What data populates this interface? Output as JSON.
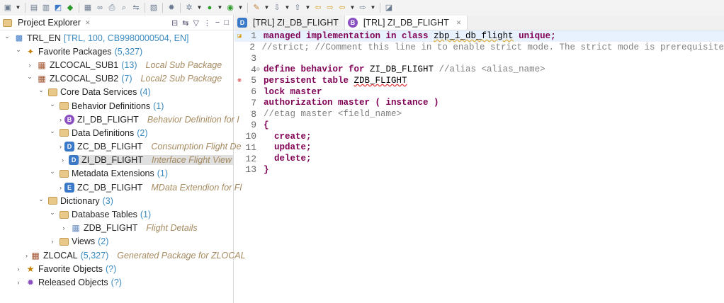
{
  "toolbar": {
    "icons": [
      "new-icon",
      "save-icon",
      "save-all-icon",
      "open-project-icon",
      "run-abap-icon",
      "package-icon",
      "link-icon",
      "print-icon",
      "search-icon",
      "compare-icon",
      "checkin-icon",
      "debug-settings-icon",
      "debug-icon",
      "run-icon",
      "external-tools-icon",
      "pen-icon",
      "next-annotation-icon",
      "prev-annotation-icon",
      "back-edit-icon",
      "forward-edit-icon",
      "back-icon",
      "forward-icon",
      "open-perspective-icon"
    ]
  },
  "explorer": {
    "title": "Project Explorer",
    "tree": [
      {
        "level": 0,
        "open": true,
        "icon": "sys",
        "label": "TRL_EN",
        "count": "[TRL, 100, CB9980000504, EN]"
      },
      {
        "level": 1,
        "open": true,
        "icon": "fav",
        "label": "Favorite Packages",
        "count": "(5,327)"
      },
      {
        "level": 2,
        "open": false,
        "icon": "pkg",
        "label": "ZLCOCAL_SUB1",
        "count": "(13)",
        "desc": "Local Sub Package"
      },
      {
        "level": 2,
        "open": true,
        "icon": "pkg",
        "label": "ZLCOCAL_SUB2",
        "count": "(7)",
        "desc": "Local2 Sub Package"
      },
      {
        "level": 3,
        "open": true,
        "icon": "folder",
        "label": "Core Data Services",
        "count": "(4)"
      },
      {
        "level": 4,
        "open": true,
        "icon": "folder",
        "label": "Behavior Definitions",
        "count": "(1)"
      },
      {
        "level": 5,
        "open": false,
        "icon": "bdef",
        "label": "ZI_DB_FLIGHT",
        "desc": "Behavior Definition for I"
      },
      {
        "level": 4,
        "open": true,
        "icon": "folder",
        "label": "Data Definitions",
        "count": "(2)"
      },
      {
        "level": 5,
        "open": false,
        "icon": "ddl",
        "label": "ZC_DB_FLIGHT",
        "desc": "Consumption Flight De"
      },
      {
        "level": 5,
        "open": false,
        "icon": "ddl",
        "label": "ZI_DB_FLIGHT",
        "desc": "Interface Flight View",
        "selected": true
      },
      {
        "level": 4,
        "open": true,
        "icon": "folder",
        "label": "Metadata Extensions",
        "count": "(1)"
      },
      {
        "level": 5,
        "open": false,
        "icon": "ext",
        "label": "ZC_DB_FLIGHT",
        "desc": "MData Extendion for Fl"
      },
      {
        "level": 3,
        "open": true,
        "icon": "folder",
        "label": "Dictionary",
        "count": "(3)"
      },
      {
        "level": 4,
        "open": true,
        "icon": "folder",
        "label": "Database Tables",
        "count": "(1)"
      },
      {
        "level": 5,
        "open": false,
        "icon": "table",
        "label": "ZDB_FLIGHT",
        "desc": "Flight Details"
      },
      {
        "level": 4,
        "open": false,
        "icon": "folder",
        "label": "Views",
        "count": "(2)"
      },
      {
        "level": 2,
        "open": false,
        "icon": "pkg",
        "label": "ZLOCAL",
        "count": "(5,327)",
        "desc": "Generated Package for ZLOCAL"
      },
      {
        "level": 1,
        "open": false,
        "icon": "star",
        "label": "Favorite Objects",
        "count": "(?)"
      },
      {
        "level": 1,
        "open": false,
        "icon": "released",
        "label": "Released Objects",
        "count": "(?)"
      }
    ]
  },
  "editor": {
    "tabs": [
      {
        "icon": "D",
        "label": "[TRL] ZI_DB_FLIGHT",
        "active": false
      },
      {
        "icon": "B",
        "label": "[TRL] ZI_DB_FLIGHT",
        "active": true
      }
    ],
    "lines": [
      {
        "n": "1",
        "marker": "warning",
        "cur": true,
        "segs": [
          [
            "kw",
            "managed implementation in class "
          ],
          [
            "warn",
            "zbp_i_db_flight"
          ],
          [
            "kw",
            " unique;"
          ]
        ]
      },
      {
        "n": "2",
        "segs": [
          [
            "cm",
            "//strict; //Comment this line in to enable strict mode. The strict mode is prerequisite"
          ]
        ]
      },
      {
        "n": "3",
        "segs": []
      },
      {
        "n": "4",
        "fold": true,
        "segs": [
          [
            "kw",
            "define behavior for "
          ],
          [
            "id",
            "ZI_DB_FLIGHT"
          ],
          [
            "cm",
            " //alias <alias_name>"
          ]
        ]
      },
      {
        "n": "5",
        "marker": "error",
        "segs": [
          [
            "kw",
            "persistent table "
          ],
          [
            "err",
            "ZDB_FLIGHT"
          ]
        ]
      },
      {
        "n": "6",
        "segs": [
          [
            "kw",
            "lock master"
          ]
        ]
      },
      {
        "n": "7",
        "segs": [
          [
            "kw",
            "authorization master ( instance )"
          ]
        ]
      },
      {
        "n": "8",
        "segs": [
          [
            "cm",
            "//etag master <field_name>"
          ]
        ]
      },
      {
        "n": "9",
        "segs": [
          [
            "kw",
            "{"
          ]
        ]
      },
      {
        "n": "10",
        "segs": [
          [
            "kw",
            "  create;"
          ]
        ]
      },
      {
        "n": "11",
        "segs": [
          [
            "kw",
            "  update;"
          ]
        ]
      },
      {
        "n": "12",
        "segs": [
          [
            "kw",
            "  delete;"
          ]
        ]
      },
      {
        "n": "13",
        "segs": [
          [
            "kw",
            "}"
          ]
        ]
      }
    ]
  }
}
